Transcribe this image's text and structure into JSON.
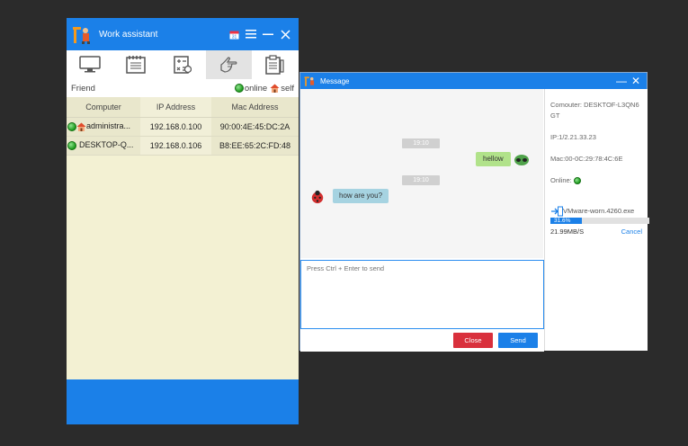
{
  "work_assistant": {
    "title": "Work assistant",
    "titlebar_icons": [
      "calendar-icon",
      "menu-icon",
      "minimize-icon",
      "close-icon"
    ],
    "toolbar": [
      {
        "name": "monitor-icon",
        "active": false
      },
      {
        "name": "notepad-icon",
        "active": false
      },
      {
        "name": "calculator-icon",
        "active": false
      },
      {
        "name": "hand-icon",
        "active": true
      },
      {
        "name": "clipboard-icon",
        "active": false
      }
    ],
    "friend_label": "Friend",
    "online_label": "online",
    "self_label": "self",
    "columns": [
      "Computer",
      "IP Address",
      "Mac Address"
    ],
    "rows": [
      {
        "computer": "administra...",
        "ip": "192.168.0.100",
        "mac": "90:00:4E:45:DC:2A",
        "self": true
      },
      {
        "computer": "DESKTOP-Q...",
        "ip": "192.168.0.106",
        "mac": "B8:EE:65:2C:FD:48",
        "self": false
      }
    ],
    "colors": {
      "accent": "#1b80e8",
      "body_bg": "#f3f1d3"
    }
  },
  "message": {
    "title": "Message",
    "timestamps": [
      "19:10",
      "19:10"
    ],
    "outgoing": "hellow",
    "incoming": "how are you?",
    "input_placeholder": "Press Ctrl + Enter to send",
    "close_label": "Close",
    "send_label": "Send",
    "info": {
      "computer": "Comouter: DESKTOF-L3QN6GT",
      "ip": "IP:1/2.21.33.23",
      "mac": "Mac:00-0C:29:78:4C:6E",
      "online": "Online:"
    },
    "file": {
      "name": "VMware-worn.4260.exe",
      "progress_text": "31.6%",
      "progress": 0.316,
      "speed": "21.99MB/S",
      "cancel_label": "Cancel"
    }
  }
}
